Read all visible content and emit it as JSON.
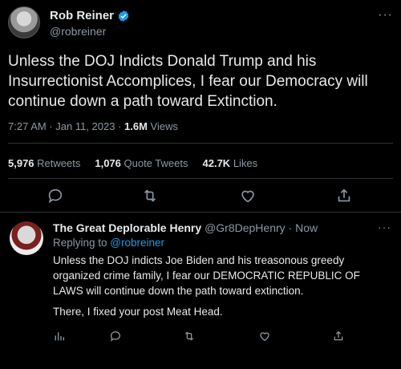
{
  "tweet": {
    "author_name": "Rob Reiner",
    "handle": "@robreiner",
    "text": "Unless the DOJ Indicts Donald Trump and his Insurrectionist Accomplices, I fear our Democracy will continue down a path toward Extinction.",
    "time": "7:27 AM · Jan 11, 2023 · ",
    "views_count": "1.6M",
    "views_label": " Views",
    "retweets_count": "5,976",
    "retweets_label": " Retweets",
    "quotes_count": "1,076",
    "quotes_label": " Quote Tweets",
    "likes_count": "42.7K",
    "likes_label": " Likes",
    "more_label": "···"
  },
  "reply": {
    "author_name": "The Great Deplorable Henry",
    "handle": "@Gr8DepHenry",
    "dot": " · ",
    "time": "Now",
    "replying_label": "Replying to ",
    "replying_to": "@robreiner",
    "text": "Unless the DOJ indicts Joe Biden and his treasonous greedy organized crime family, I fear our DEMOCRATIC REPUBLIC OF LAWS will continue down the path toward extinction.",
    "text2": "There, I fixed your post Meat Head.",
    "more_label": "···"
  },
  "colors": {
    "background": "#000000",
    "text": "#e7e9ea",
    "secondary": "#8b98a5",
    "accent": "#1d9bf0",
    "divider": "#2f3336"
  },
  "icons": [
    "verified-badge-icon",
    "reply-icon",
    "retweet-icon",
    "like-icon",
    "share-icon",
    "analytics-icon"
  ]
}
